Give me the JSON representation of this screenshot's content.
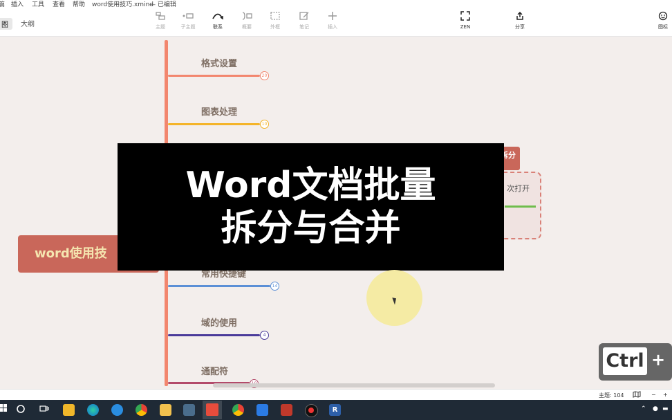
{
  "menubar": {
    "items": [
      "插入",
      "工具",
      "查看",
      "帮助"
    ],
    "file_title": "word使用技巧.xmind",
    "edit_status": "— 已编辑"
  },
  "view_tabs": [
    "图",
    "大纲"
  ],
  "toolbar": {
    "tools": [
      {
        "label": "主题",
        "icon": "topic-icon"
      },
      {
        "label": "子主题",
        "icon": "subtopic-icon"
      },
      {
        "label": "联系",
        "icon": "relationship-icon"
      },
      {
        "label": "概要",
        "icon": "summary-icon"
      },
      {
        "label": "外框",
        "icon": "boundary-icon"
      },
      {
        "label": "笔记",
        "icon": "note-icon"
      },
      {
        "label": "插入",
        "icon": "plus-icon"
      }
    ],
    "zen_label": "ZEN",
    "share_label": "分享",
    "icon_label": "图标"
  },
  "mindmap": {
    "central_topic": "word使用技",
    "branches": [
      {
        "label": "格式设置",
        "count": "20",
        "color": "#f2866e"
      },
      {
        "label": "图表处理",
        "count": "10",
        "color": "#f4b429"
      },
      {
        "label": "常用快捷键",
        "count": "14",
        "color": "#5b8fd6"
      },
      {
        "label": "域的使用",
        "count": "4",
        "color": "#4a3b9a"
      },
      {
        "label": "通配符",
        "count": "10",
        "color": "#b34a6a"
      }
    ],
    "split_header": "拆分",
    "split_text": "次打开"
  },
  "overlay": {
    "line1": "Word文档批量",
    "line2": "拆分与合并"
  },
  "key_overlay": {
    "key": "Ctrl",
    "plus": "+"
  },
  "status": {
    "topics_label": "主题: 104",
    "zoom_minus": "−",
    "zoom_plus": "+"
  }
}
